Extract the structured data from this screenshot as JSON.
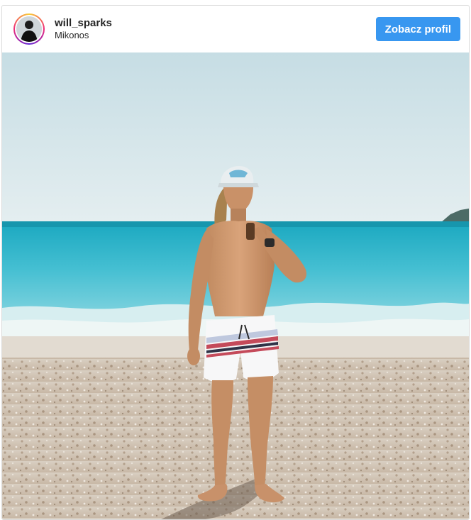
{
  "post": {
    "username": "will_sparks",
    "location": "Mikonos",
    "view_profile_label": "Zobacz profil"
  },
  "photo": {
    "subject": "man-on-beach",
    "scene": "sea-and-pebble-beach"
  },
  "colors": {
    "button_blue": "#3897f0",
    "text_dark": "#262626",
    "border": "#dbdbdb"
  },
  "icons": {
    "avatar": "avatar-icon"
  }
}
